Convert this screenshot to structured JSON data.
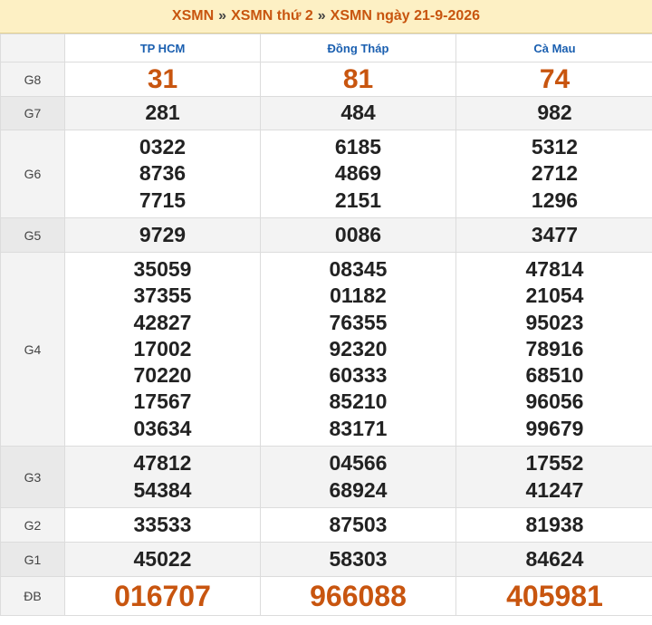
{
  "breadcrumb": {
    "items": [
      "XSMN",
      "XSMN thứ 2",
      "XSMN ngày 21-9-2026"
    ],
    "separator": "»"
  },
  "table": {
    "provinces": [
      "TP HCM",
      "Đồng Tháp",
      "Cà Mau"
    ],
    "prizes": [
      {
        "label": "G8",
        "values": [
          [
            "31"
          ],
          [
            "81"
          ],
          [
            "74"
          ]
        ]
      },
      {
        "label": "G7",
        "values": [
          [
            "281"
          ],
          [
            "484"
          ],
          [
            "982"
          ]
        ]
      },
      {
        "label": "G6",
        "values": [
          [
            "0322",
            "8736",
            "7715"
          ],
          [
            "6185",
            "4869",
            "2151"
          ],
          [
            "5312",
            "2712",
            "1296"
          ]
        ]
      },
      {
        "label": "G5",
        "values": [
          [
            "9729"
          ],
          [
            "0086"
          ],
          [
            "3477"
          ]
        ]
      },
      {
        "label": "G4",
        "values": [
          [
            "35059",
            "37355",
            "42827",
            "17002",
            "70220",
            "17567",
            "03634"
          ],
          [
            "08345",
            "01182",
            "76355",
            "92320",
            "60333",
            "85210",
            "83171"
          ],
          [
            "47814",
            "21054",
            "95023",
            "78916",
            "68510",
            "96056",
            "99679"
          ]
        ]
      },
      {
        "label": "G3",
        "values": [
          [
            "47812",
            "54384"
          ],
          [
            "04566",
            "68924"
          ],
          [
            "17552",
            "41247"
          ]
        ]
      },
      {
        "label": "G2",
        "values": [
          [
            "33533"
          ],
          [
            "87503"
          ],
          [
            "81938"
          ]
        ]
      },
      {
        "label": "G1",
        "values": [
          [
            "45022"
          ],
          [
            "58303"
          ],
          [
            "84624"
          ]
        ]
      },
      {
        "label": "ĐB",
        "values": [
          [
            "016707"
          ],
          [
            "966088"
          ],
          [
            "405981"
          ]
        ]
      }
    ]
  },
  "colors": {
    "accent": "#c8550f",
    "header_bg": "#fdf0c4",
    "province_text": "#1a5fb0"
  }
}
